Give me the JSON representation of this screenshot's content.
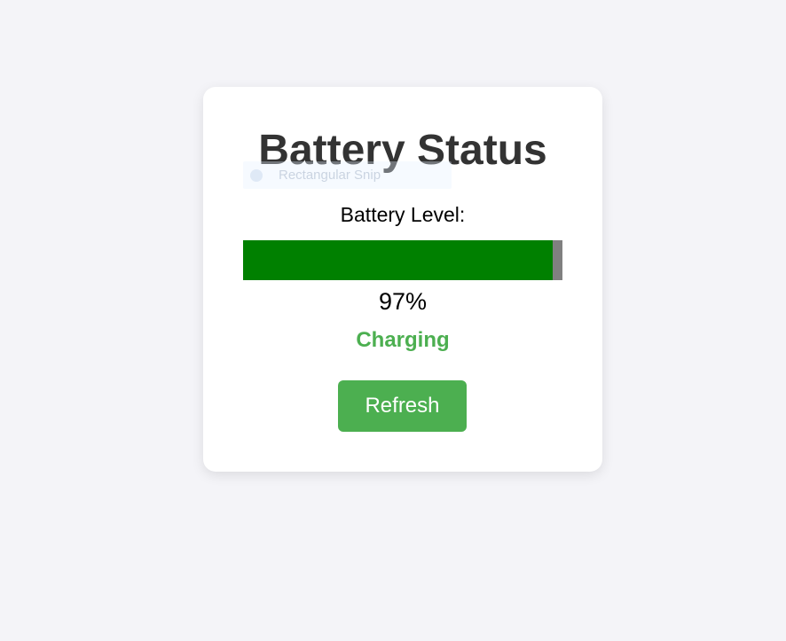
{
  "page": {
    "title": "Battery Status"
  },
  "overlay": {
    "label": "Rectangular Snip"
  },
  "battery": {
    "level_label": "Battery Level:",
    "level_percent": 97,
    "level_text": "97%",
    "status": "Charging"
  },
  "actions": {
    "refresh_label": "Refresh"
  },
  "colors": {
    "background": "#f4f4f8",
    "card": "#ffffff",
    "title": "#333333",
    "bar_fill": "#008000",
    "bar_track": "#808080",
    "status": "#4caf50",
    "button": "#4caf50",
    "button_text": "#ffffff"
  }
}
